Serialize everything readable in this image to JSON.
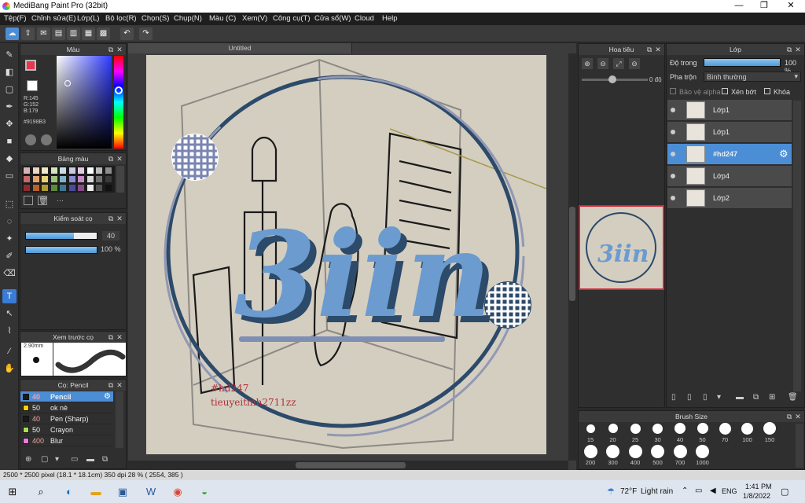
{
  "window": {
    "title": "MediBang Paint Pro (32bit)",
    "minimize": "—",
    "restore": "❐",
    "close": "✕"
  },
  "menu": [
    "Tệp(F)",
    "Chỉnh sửa(E)",
    "Lớp(L)",
    "Bộ lọc(R)",
    "Chọn(S)",
    "Chụp(N)",
    "Màu (C)",
    "Xem(V)",
    "Công cụ(T)",
    "Cửa sổ(W)",
    "Cloud",
    "Help"
  ],
  "toolbar": {
    "undo": "↶",
    "redo": "↷"
  },
  "color_panel": {
    "title": "Màu",
    "r": "R:145",
    "g": "G:152",
    "b": "B:179",
    "hex": "#9198B3",
    "primary": "#e8364f",
    "accent": "#4b8ed6"
  },
  "palette_panel": {
    "title": "Bảng màu",
    "more": "···"
  },
  "brush_control": {
    "title": "Kiểm soát cọ",
    "size": "40",
    "opacity": "100 %",
    "size_fraction": 0.68,
    "opacity_fraction": 1.0
  },
  "brush_preview": {
    "title": "Xem trước cọ",
    "size": "2.90mm"
  },
  "brush_list": {
    "title": "Cọ: Pencil",
    "items": [
      {
        "size": "40",
        "name": "Pencil",
        "color": "#1a1a1a"
      },
      {
        "size": "50",
        "name": "ok nè",
        "color": "#f5d400"
      },
      {
        "size": "40",
        "name": "Pen (Sharp)",
        "color": "#1a1a1a"
      },
      {
        "size": "50",
        "name": "Crayon",
        "color": "#a6e34a"
      },
      {
        "size": "400",
        "name": "Blur",
        "color": "#f07ad8"
      }
    ]
  },
  "canvas": {
    "doc_tab": "Untitled",
    "logo_text": "3iin",
    "watermark_line1": "#hd247",
    "watermark_line2": "tieuyeitinh2711zz",
    "circle_color": "#2c4a6a",
    "logo_color": "#6b9bcf"
  },
  "navigator": {
    "title": "Hoa tiêu",
    "angle": "0 độ"
  },
  "layers": {
    "title": "Lớp",
    "opacity_label": "Độ trong",
    "opacity_value": "100 %",
    "blend_label": "Pha trộn",
    "blend_value": "Bình thường",
    "protect_alpha": "Bảo vệ alpha",
    "clipping": "Xén bớt",
    "lock": "Khóa",
    "items": [
      {
        "name": "Lớp1"
      },
      {
        "name": "Lớp1"
      },
      {
        "name": "#hd247"
      },
      {
        "name": "Lớp4"
      },
      {
        "name": "Lớp2"
      }
    ]
  },
  "brush_size": {
    "title": "Brush Size",
    "row1": [
      "15",
      "20",
      "25",
      "30",
      "40",
      "50",
      "70",
      "100",
      "150"
    ],
    "row2": [
      "200",
      "300",
      "400",
      "500",
      "700",
      "1000"
    ]
  },
  "status": {
    "text": "2500 * 2500 pixel   (18.1 * 18.1cm)   350 dpi   28 %   ( 2554, 385 )"
  },
  "taskbar": {
    "weather_temp": "72°F",
    "weather_desc": "Light rain",
    "lang": "ENG",
    "time": "1:41 PM",
    "date": "1/8/2022"
  }
}
